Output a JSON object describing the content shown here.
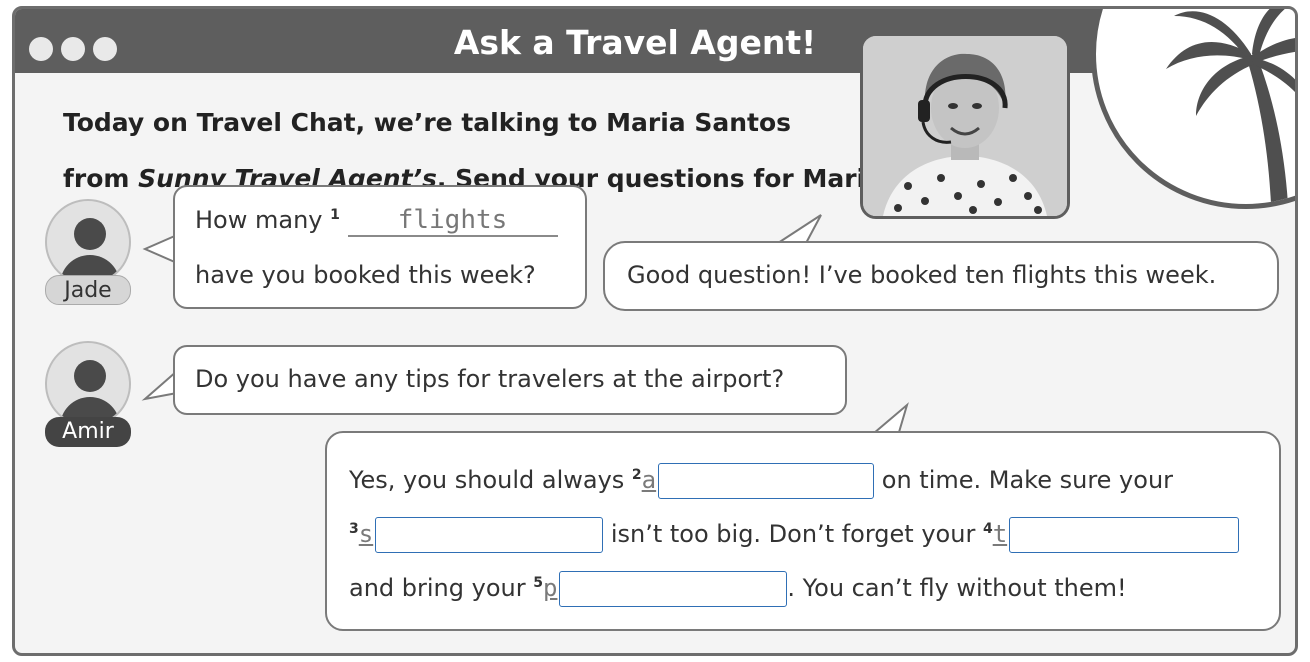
{
  "header": {
    "title": "Ask a Travel Agent!"
  },
  "intro": {
    "line1": "Today on Travel Chat, we’re talking to Maria Santos",
    "line2_start": "from ",
    "line2_company": "Sunny Travel Agent’s",
    "line2_end": ". Send your questions for Maria!"
  },
  "chat": {
    "jade": {
      "name": "Jade",
      "question_part1": "How many ",
      "blank_number": "1",
      "blank_answer": "flights",
      "question_part2": "have you booked this week?"
    },
    "maria_reply1": "Good question! I’ve booked ten flights this week.",
    "amir": {
      "name": "Amir",
      "question": "Do you have any tips for travelers at the airport?"
    },
    "maria_reply2": {
      "part1": "Yes, you should always ",
      "n2": "2",
      "letter2": "a",
      "part2": " on time. Make sure your",
      "n3": "3",
      "letter3": "s",
      "part3": " isn’t too big. Don’t forget your ",
      "n4": "4",
      "letter4": "t",
      "part4": "and bring your ",
      "n5": "5",
      "letter5": "p",
      "part5": ". You can’t fly without them!"
    }
  },
  "colors": {
    "titlebar": "#5e5e5e",
    "input_border": "#2f6fb5"
  }
}
